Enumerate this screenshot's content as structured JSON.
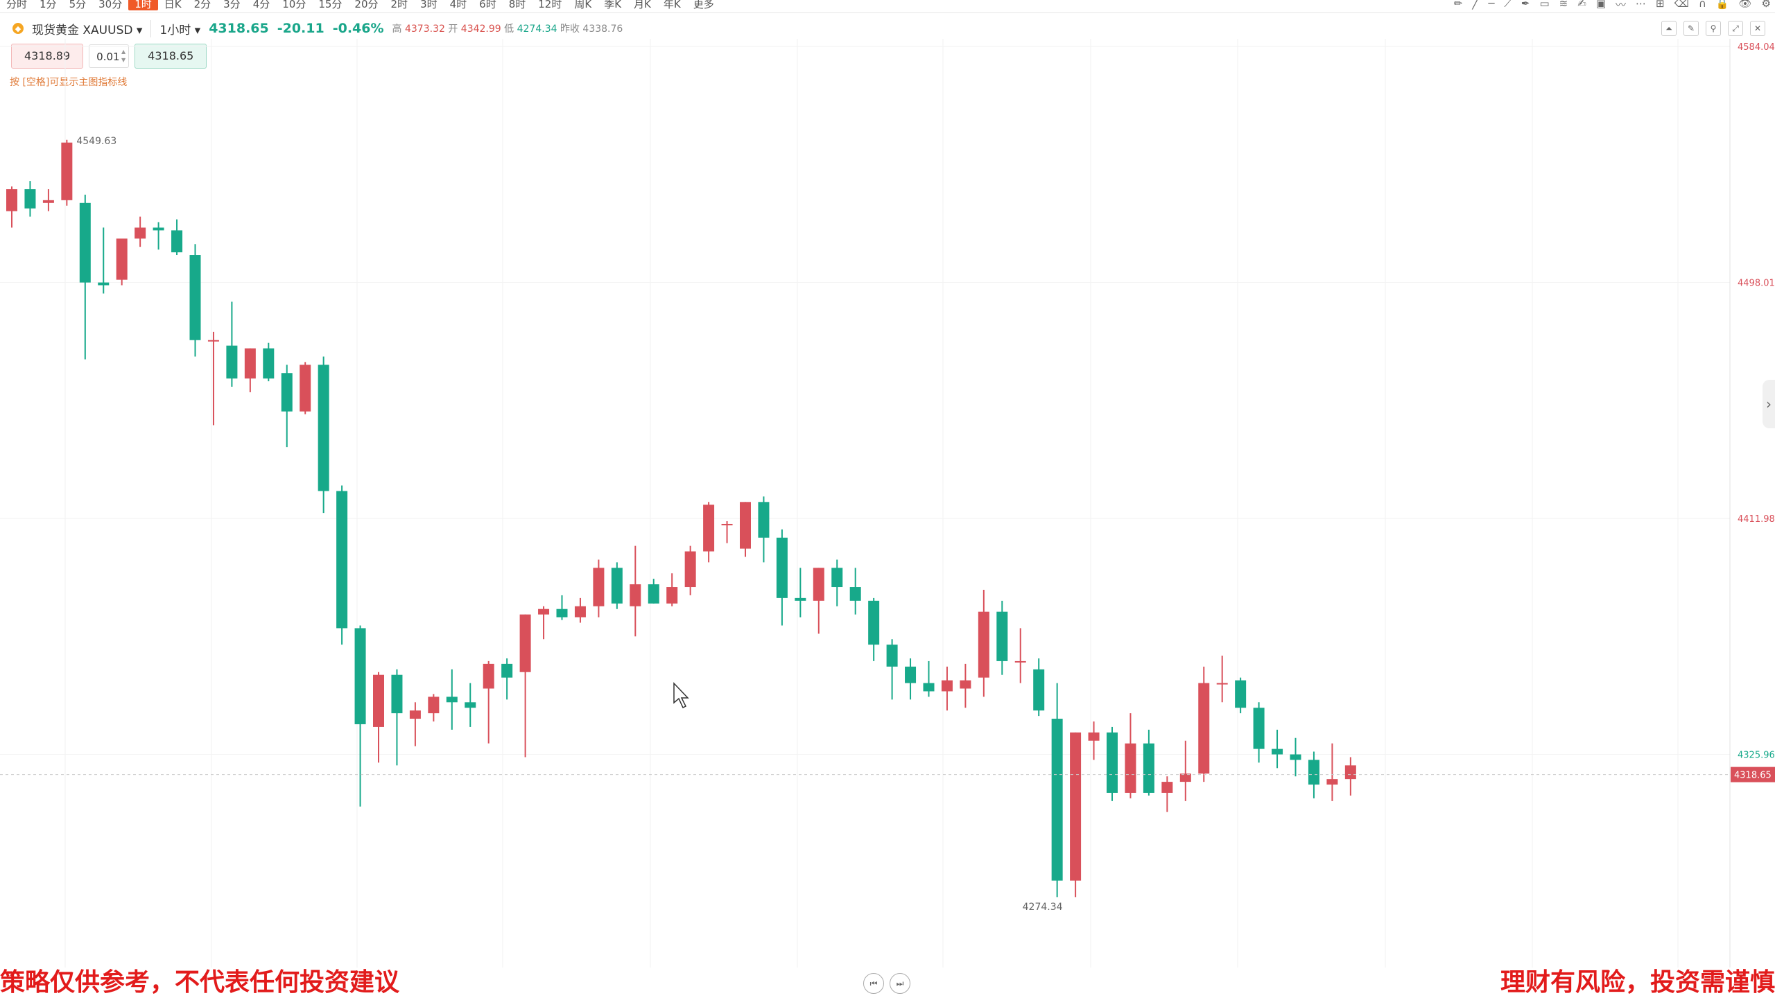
{
  "toolbar": {
    "timeframes": [
      "分时",
      "1分",
      "5分",
      "30分",
      "1时",
      "日K",
      "2分",
      "3分",
      "4分",
      "10分",
      "15分",
      "20分",
      "2时",
      "3时",
      "4时",
      "6时",
      "8时",
      "12时",
      "周K",
      "季K",
      "月K",
      "年K",
      "更多"
    ],
    "active_index": 4,
    "tool_icons": [
      "pencil-icon",
      "ray-icon",
      "hline-icon",
      "trend-icon",
      "brush-icon",
      "ruler-icon",
      "fib-icon",
      "pen-icon",
      "image-icon",
      "wave-icon",
      "more-icon",
      "layout-icon",
      "eraser-icon",
      "magnet-icon",
      "lock-icon",
      "eye-icon",
      "settings-icon"
    ]
  },
  "info": {
    "symbol_name": "现货黄金",
    "symbol_code": "XAUUSD",
    "symbol_arrow": "▾",
    "period": "1小时",
    "period_arrow": "▾",
    "last": "4318.65",
    "change": "-20.11",
    "change_pct": "-0.46%",
    "high_label": "高",
    "high": "4373.32",
    "open_label": "开",
    "open": "4342.99",
    "low_label": "低",
    "low": "4274.34",
    "prev_label": "昨收",
    "prev": "4338.76"
  },
  "order": {
    "sell": "4318.89",
    "qty": "0.01",
    "buy": "4318.65"
  },
  "hint": "按 [空格]可显示主图指标线",
  "disclaimer": {
    "left": "策略仅供参考，不代表任何投资建议",
    "right": "理财有风险，投资需谨慎"
  },
  "colors": {
    "up": "#17a98a",
    "down": "#d9505a",
    "grid": "#f2f2f2",
    "price_line": "#d9505a"
  },
  "chart_data": {
    "type": "candlestick",
    "ylim": [
      4265,
      4584.04
    ],
    "y_ticks": [
      "4584.04",
      "4498.01",
      "4411.98",
      "4325.96"
    ],
    "current_price": "4318.65",
    "max_label": "4549.63",
    "min_label": "4274.34",
    "candles": [
      {
        "o": 4524,
        "h": 4533,
        "l": 4518,
        "c": 4532
      },
      {
        "o": 4532,
        "h": 4535,
        "l": 4522,
        "c": 4525
      },
      {
        "o": 4527,
        "h": 4532,
        "l": 4524,
        "c": 4528
      },
      {
        "o": 4528,
        "h": 4550,
        "l": 4526,
        "c": 4549
      },
      {
        "o": 4527,
        "h": 4530,
        "l": 4470,
        "c": 4498
      },
      {
        "o": 4498,
        "h": 4518,
        "l": 4494,
        "c": 4497
      },
      {
        "o": 4499,
        "h": 4512,
        "l": 4497,
        "c": 4514
      },
      {
        "o": 4514,
        "h": 4522,
        "l": 4511,
        "c": 4518
      },
      {
        "o": 4518,
        "h": 4520,
        "l": 4510,
        "c": 4517
      },
      {
        "o": 4517,
        "h": 4521,
        "l": 4508,
        "c": 4509
      },
      {
        "o": 4508,
        "h": 4512,
        "l": 4471,
        "c": 4477
      },
      {
        "o": 4477,
        "h": 4480,
        "l": 4446,
        "c": 4477
      },
      {
        "o": 4475,
        "h": 4491,
        "l": 4460,
        "c": 4463
      },
      {
        "o": 4463,
        "h": 4474,
        "l": 4458,
        "c": 4474
      },
      {
        "o": 4474,
        "h": 4476,
        "l": 4462,
        "c": 4463
      },
      {
        "o": 4465,
        "h": 4468,
        "l": 4438,
        "c": 4451
      },
      {
        "o": 4451,
        "h": 4469,
        "l": 4450,
        "c": 4468
      },
      {
        "o": 4468,
        "h": 4471,
        "l": 4414,
        "c": 4422
      },
      {
        "o": 4422,
        "h": 4424,
        "l": 4366,
        "c": 4372
      },
      {
        "o": 4372,
        "h": 4373,
        "l": 4307,
        "c": 4337
      },
      {
        "o": 4336,
        "h": 4356,
        "l": 4323,
        "c": 4355
      },
      {
        "o": 4355,
        "h": 4357,
        "l": 4322,
        "c": 4341
      },
      {
        "o": 4339,
        "h": 4345,
        "l": 4329,
        "c": 4342
      },
      {
        "o": 4341,
        "h": 4348,
        "l": 4338,
        "c": 4347
      },
      {
        "o": 4347,
        "h": 4357,
        "l": 4335,
        "c": 4345
      },
      {
        "o": 4345,
        "h": 4352,
        "l": 4336,
        "c": 4343
      },
      {
        "o": 4350,
        "h": 4360,
        "l": 4330,
        "c": 4359
      },
      {
        "o": 4359,
        "h": 4361,
        "l": 4346,
        "c": 4354
      },
      {
        "o": 4356,
        "h": 4377,
        "l": 4325,
        "c": 4377
      },
      {
        "o": 4377,
        "h": 4380,
        "l": 4368,
        "c": 4379
      },
      {
        "o": 4379,
        "h": 4384,
        "l": 4375,
        "c": 4376
      },
      {
        "o": 4376,
        "h": 4383,
        "l": 4374,
        "c": 4380
      },
      {
        "o": 4380,
        "h": 4397,
        "l": 4376,
        "c": 4394
      },
      {
        "o": 4394,
        "h": 4396,
        "l": 4379,
        "c": 4381
      },
      {
        "o": 4380,
        "h": 4402,
        "l": 4369,
        "c": 4388
      },
      {
        "o": 4388,
        "h": 4390,
        "l": 4381,
        "c": 4381
      },
      {
        "o": 4381,
        "h": 4392,
        "l": 4380,
        "c": 4387
      },
      {
        "o": 4387,
        "h": 4402,
        "l": 4384,
        "c": 4400
      },
      {
        "o": 4400,
        "h": 4418,
        "l": 4396,
        "c": 4417
      },
      {
        "o": 4410,
        "h": 4411,
        "l": 4403,
        "c": 4410
      },
      {
        "o": 4401,
        "h": 4418,
        "l": 4398,
        "c": 4418
      },
      {
        "o": 4418,
        "h": 4420,
        "l": 4396,
        "c": 4405
      },
      {
        "o": 4405,
        "h": 4408,
        "l": 4373,
        "c": 4383
      },
      {
        "o": 4383,
        "h": 4394,
        "l": 4376,
        "c": 4382
      },
      {
        "o": 4382,
        "h": 4394,
        "l": 4370,
        "c": 4394
      },
      {
        "o": 4394,
        "h": 4397,
        "l": 4380,
        "c": 4387
      },
      {
        "o": 4387,
        "h": 4394,
        "l": 4377,
        "c": 4382
      },
      {
        "o": 4382,
        "h": 4383,
        "l": 4360,
        "c": 4366
      },
      {
        "o": 4366,
        "h": 4368,
        "l": 4346,
        "c": 4358
      },
      {
        "o": 4358,
        "h": 4361,
        "l": 4346,
        "c": 4352
      },
      {
        "o": 4352,
        "h": 4360,
        "l": 4347,
        "c": 4349
      },
      {
        "o": 4349,
        "h": 4358,
        "l": 4342,
        "c": 4353
      },
      {
        "o": 4350,
        "h": 4359,
        "l": 4343,
        "c": 4353
      },
      {
        "o": 4354,
        "h": 4386,
        "l": 4347,
        "c": 4378
      },
      {
        "o": 4378,
        "h": 4382,
        "l": 4355,
        "c": 4360
      },
      {
        "o": 4360,
        "h": 4372,
        "l": 4352,
        "c": 4360
      },
      {
        "o": 4357,
        "h": 4361,
        "l": 4340,
        "c": 4342
      },
      {
        "o": 4339,
        "h": 4352,
        "l": 4274,
        "c": 4280
      },
      {
        "o": 4280,
        "h": 4334,
        "l": 4274,
        "c": 4334
      },
      {
        "o": 4331,
        "h": 4338,
        "l": 4324,
        "c": 4334
      },
      {
        "o": 4334,
        "h": 4336,
        "l": 4309,
        "c": 4312
      },
      {
        "o": 4312,
        "h": 4341,
        "l": 4310,
        "c": 4330
      },
      {
        "o": 4330,
        "h": 4335,
        "l": 4311,
        "c": 4312
      },
      {
        "o": 4312,
        "h": 4318,
        "l": 4305,
        "c": 4316
      },
      {
        "o": 4316,
        "h": 4331,
        "l": 4309,
        "c": 4319
      },
      {
        "o": 4319,
        "h": 4358,
        "l": 4316,
        "c": 4352
      },
      {
        "o": 4352,
        "h": 4362,
        "l": 4345,
        "c": 4352
      },
      {
        "o": 4353,
        "h": 4354,
        "l": 4341,
        "c": 4343
      },
      {
        "o": 4343,
        "h": 4345,
        "l": 4323,
        "c": 4328
      },
      {
        "o": 4328,
        "h": 4335,
        "l": 4321,
        "c": 4326
      },
      {
        "o": 4326,
        "h": 4332,
        "l": 4318,
        "c": 4324
      },
      {
        "o": 4324,
        "h": 4327,
        "l": 4310,
        "c": 4315
      },
      {
        "o": 4315,
        "h": 4330,
        "l": 4309,
        "c": 4317
      },
      {
        "o": 4317,
        "h": 4325,
        "l": 4311,
        "c": 4322
      }
    ]
  }
}
